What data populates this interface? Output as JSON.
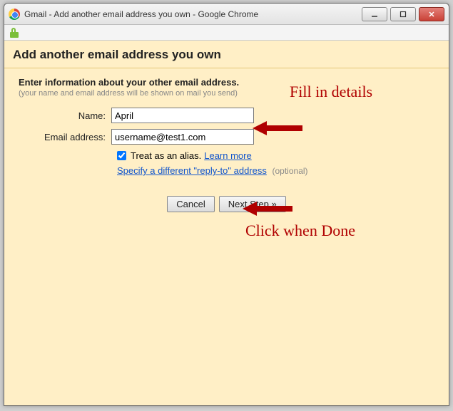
{
  "window": {
    "title": "Gmail - Add another email address you own - Google Chrome"
  },
  "page": {
    "heading": "Add another email address you own",
    "subheading": "Enter information about your other email address.",
    "hint": "(your name and email address will be shown on mail you send)"
  },
  "form": {
    "name_label": "Name:",
    "name_value": "April",
    "email_label": "Email address:",
    "email_value": "username@test1.com",
    "alias_label": "Treat as an alias.",
    "alias_checked": true,
    "learn_more": "Learn more",
    "reply_to_link": "Specify a different \"reply-to\" address",
    "optional": "(optional)"
  },
  "buttons": {
    "cancel": "Cancel",
    "next": "Next Step »"
  },
  "annotations": {
    "fill": "Fill in details",
    "click": "Click when Done"
  }
}
